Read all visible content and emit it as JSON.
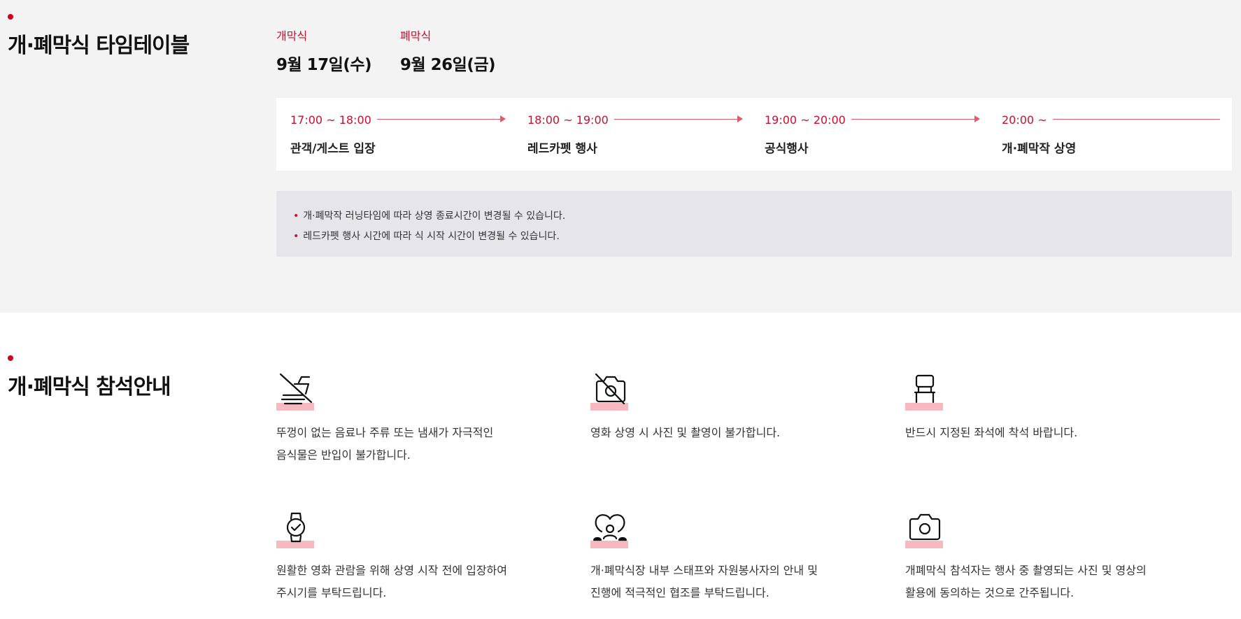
{
  "timetable": {
    "title": "개·폐막식 타임테이블",
    "opening": {
      "label": "개막식",
      "date": "9월 17일(수)"
    },
    "closing": {
      "label": "폐막식",
      "date": "9월 26일(금)"
    },
    "steps": [
      {
        "time": "17:00 ~ 18:00",
        "label": "관객/게스트 입장"
      },
      {
        "time": "18:00 ~ 19:00",
        "label": "레드카펫 행사"
      },
      {
        "time": "19:00 ~ 20:00",
        "label": "공식행사"
      },
      {
        "time": "20:00 ~",
        "label": "개·폐막작 상영"
      }
    ],
    "notices": [
      "개·폐막작 러닝타임에 따라 상영 종료시간이 변경될 수 있습니다.",
      "레드카펫 행사 시간에 따라 식 시작 시간이 변경될 수 있습니다."
    ],
    "notice_bullet": "•"
  },
  "seating": {
    "title": "개·폐막식 참석안내",
    "rules": [
      {
        "icon": "no-food-drink-icon",
        "text": "뚜껑이 없는 음료나 주류 또는 냄새가 자극적인\n음식물은 반입이 불가합니다."
      },
      {
        "icon": "no-camera-icon",
        "text": "영화 상영 시 사진 및 촬영이 불가합니다."
      },
      {
        "icon": "seat-icon",
        "text": "반드시 지정된 좌석에 착석 바랍니다."
      },
      {
        "icon": "watch-check-icon",
        "text": "원활한 영화 관람을 위해 상영 시작 전에 입장하여\n주시기를 부탁드립니다."
      },
      {
        "icon": "staff-guide-icon",
        "text": "개·폐막식장 내부 스태프와 자원봉사자의 안내 및\n진행에 적극적인 협조를 부탁드립니다."
      },
      {
        "icon": "camera-icon",
        "text": "개폐막식 참석자는 행사 중 촬영되는 사진 및 영상의\n활용에 동의하는 것으로 간주됩니다."
      }
    ]
  },
  "colors": {
    "accent_red": "#c8102e",
    "icon_highlight": "#f6b9bf",
    "top_background": "#f3f3f3",
    "notice_background": "#e5e5ea"
  }
}
